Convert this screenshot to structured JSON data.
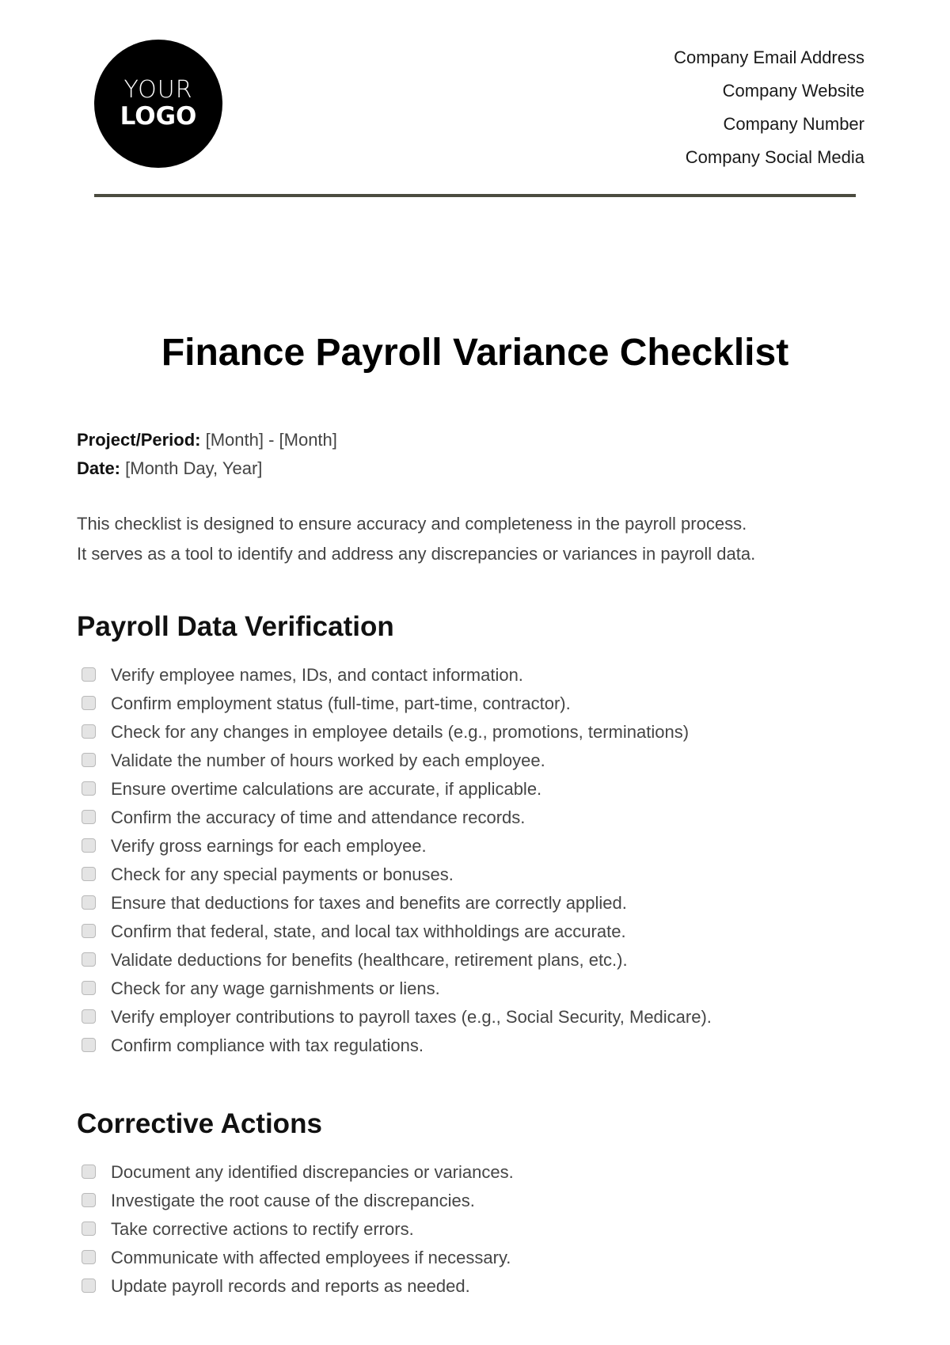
{
  "header": {
    "logo": {
      "line1": "YOUR",
      "line2": "LOGO"
    },
    "contact": [
      "Company Email Address",
      "Company Website",
      "Company Number",
      "Company Social Media"
    ],
    "rule_color": "#4b4c40"
  },
  "title": "Finance Payroll Variance Checklist",
  "meta": {
    "period_label": "Project/Period:",
    "period_value": " [Month] - [Month]",
    "date_label": "Date:",
    "date_value": " [Month Day, Year]"
  },
  "intro": [
    "This checklist is designed to ensure accuracy and completeness in the payroll process.",
    "It serves as a tool to identify and address any discrepancies or variances in payroll data."
  ],
  "sections": [
    {
      "heading": "Payroll Data Verification",
      "items": [
        {
          "label": "Verify employee names, IDs, and contact information.",
          "checked": false
        },
        {
          "label": "Confirm employment status (full-time, part-time, contractor).",
          "checked": false
        },
        {
          "label": "Check for any changes in employee details (e.g., promotions, terminations)",
          "checked": false
        },
        {
          "label": "Validate the number of hours worked by each employee.",
          "checked": false
        },
        {
          "label": "Ensure overtime calculations are accurate, if applicable.",
          "checked": false
        },
        {
          "label": "Confirm the accuracy of time and attendance records.",
          "checked": false
        },
        {
          "label": "Verify gross earnings for each employee.",
          "checked": false
        },
        {
          "label": "Check for any special payments or bonuses.",
          "checked": false
        },
        {
          "label": "Ensure that deductions for taxes and benefits are correctly applied.",
          "checked": false
        },
        {
          "label": "Confirm that federal, state, and local tax withholdings are accurate.",
          "checked": false
        },
        {
          "label": "Validate deductions for benefits (healthcare, retirement plans, etc.).",
          "checked": false
        },
        {
          "label": "Check for any wage garnishments or liens.",
          "checked": false
        },
        {
          "label": "Verify employer contributions to payroll taxes (e.g., Social Security, Medicare).",
          "checked": false
        },
        {
          "label": "Confirm compliance with tax regulations.",
          "checked": false
        }
      ]
    },
    {
      "heading": "Corrective Actions",
      "items": [
        {
          "label": "Document any identified discrepancies or variances.",
          "checked": false
        },
        {
          "label": "Investigate the root cause of the discrepancies.",
          "checked": false
        },
        {
          "label": "Take corrective actions to rectify errors.",
          "checked": false
        },
        {
          "label": "Communicate with affected employees if necessary.",
          "checked": false
        },
        {
          "label": "Update payroll records and reports as needed.",
          "checked": false
        }
      ]
    }
  ]
}
